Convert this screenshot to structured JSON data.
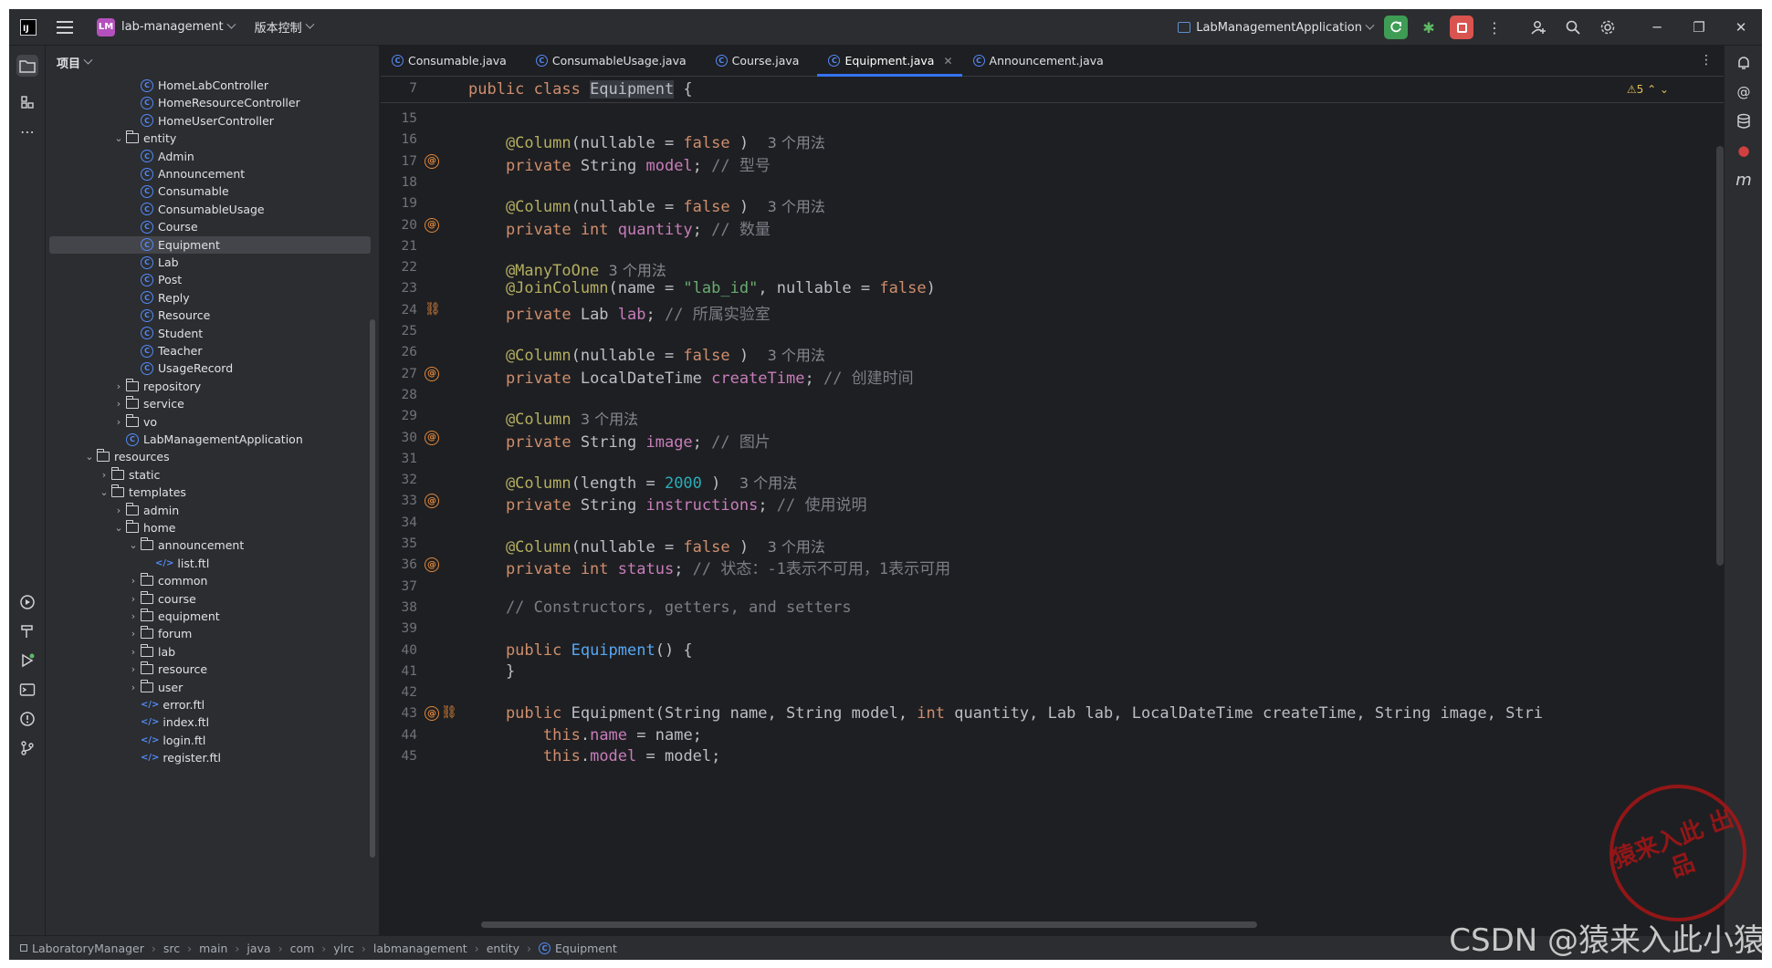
{
  "topbar": {
    "project_badge": "LM",
    "project_name": "lab-management",
    "vcs_label": "版本控制",
    "run_config": "LabManagementApplication"
  },
  "project_panel": {
    "title": "项目",
    "tree": [
      {
        "label": "HomeLabController",
        "type": "class",
        "depth": 5
      },
      {
        "label": "HomeResourceController",
        "type": "class",
        "depth": 5
      },
      {
        "label": "HomeUserController",
        "type": "class",
        "depth": 5
      },
      {
        "label": "entity",
        "type": "folder",
        "depth": 4,
        "expanded": true
      },
      {
        "label": "Admin",
        "type": "class",
        "depth": 5
      },
      {
        "label": "Announcement",
        "type": "class",
        "depth": 5
      },
      {
        "label": "Consumable",
        "type": "class",
        "depth": 5
      },
      {
        "label": "ConsumableUsage",
        "type": "class",
        "depth": 5
      },
      {
        "label": "Course",
        "type": "class",
        "depth": 5
      },
      {
        "label": "Equipment",
        "type": "class",
        "depth": 5,
        "selected": true
      },
      {
        "label": "Lab",
        "type": "class",
        "depth": 5
      },
      {
        "label": "Post",
        "type": "class",
        "depth": 5
      },
      {
        "label": "Reply",
        "type": "class",
        "depth": 5
      },
      {
        "label": "Resource",
        "type": "class",
        "depth": 5
      },
      {
        "label": "Student",
        "type": "class",
        "depth": 5
      },
      {
        "label": "Teacher",
        "type": "class",
        "depth": 5
      },
      {
        "label": "UsageRecord",
        "type": "class",
        "depth": 5
      },
      {
        "label": "repository",
        "type": "folder",
        "depth": 4,
        "expanded": false
      },
      {
        "label": "service",
        "type": "folder",
        "depth": 4,
        "expanded": false
      },
      {
        "label": "vo",
        "type": "folder",
        "depth": 4,
        "expanded": false
      },
      {
        "label": "LabManagementApplication",
        "type": "class",
        "depth": 4
      },
      {
        "label": "resources",
        "type": "folder",
        "depth": 2,
        "expanded": true
      },
      {
        "label": "static",
        "type": "folder",
        "depth": 3,
        "expanded": false
      },
      {
        "label": "templates",
        "type": "folder",
        "depth": 3,
        "expanded": true
      },
      {
        "label": "admin",
        "type": "folder",
        "depth": 4,
        "expanded": false
      },
      {
        "label": "home",
        "type": "folder",
        "depth": 4,
        "expanded": true
      },
      {
        "label": "announcement",
        "type": "folder",
        "depth": 5,
        "expanded": true
      },
      {
        "label": "list.ftl",
        "type": "ftl",
        "depth": 6
      },
      {
        "label": "common",
        "type": "folder",
        "depth": 5,
        "expanded": false
      },
      {
        "label": "course",
        "type": "folder",
        "depth": 5,
        "expanded": false
      },
      {
        "label": "equipment",
        "type": "folder",
        "depth": 5,
        "expanded": false
      },
      {
        "label": "forum",
        "type": "folder",
        "depth": 5,
        "expanded": false
      },
      {
        "label": "lab",
        "type": "folder",
        "depth": 5,
        "expanded": false
      },
      {
        "label": "resource",
        "type": "folder",
        "depth": 5,
        "expanded": false
      },
      {
        "label": "user",
        "type": "folder",
        "depth": 5,
        "expanded": false
      },
      {
        "label": "error.ftl",
        "type": "ftl",
        "depth": 5
      },
      {
        "label": "index.ftl",
        "type": "ftl",
        "depth": 5
      },
      {
        "label": "login.ftl",
        "type": "ftl",
        "depth": 5
      },
      {
        "label": "register.ftl",
        "type": "ftl",
        "depth": 5
      }
    ]
  },
  "tabs": [
    {
      "label": "Consumable.java",
      "active": false
    },
    {
      "label": "ConsumableUsage.java",
      "active": false
    },
    {
      "label": "Course.java",
      "active": false
    },
    {
      "label": "Equipment.java",
      "active": true
    },
    {
      "label": "Announcement.java",
      "active": false
    }
  ],
  "editor": {
    "sticky_line_number": "7",
    "sticky_header": "public class Equipment {",
    "warnings_count": "5",
    "line_numbers": [
      "15",
      "16",
      "17",
      "18",
      "19",
      "20",
      "21",
      "22",
      "23",
      "24",
      "25",
      "26",
      "27",
      "28",
      "29",
      "30",
      "31",
      "32",
      "33",
      "34",
      "35",
      "36",
      "37",
      "38",
      "39",
      "40",
      "41",
      "42",
      "43",
      "44",
      "45"
    ],
    "code": [
      {
        "n": "15",
        "tokens": []
      },
      {
        "n": "16",
        "tokens": [
          [
            "ann",
            "    @Column"
          ],
          [
            "",
            "(nullable = "
          ],
          [
            "kw",
            "false"
          ],
          [
            "",
            " )  "
          ],
          [
            "hint",
            "3 个用法"
          ]
        ]
      },
      {
        "n": "17",
        "mark": "at",
        "tokens": [
          [
            "kw",
            "    private "
          ],
          [
            "",
            "String "
          ],
          [
            "fld",
            "model"
          ],
          [
            "",
            "; "
          ],
          [
            "cmt",
            "// 型号"
          ]
        ]
      },
      {
        "n": "18",
        "tokens": []
      },
      {
        "n": "19",
        "tokens": [
          [
            "ann",
            "    @Column"
          ],
          [
            "",
            "(nullable = "
          ],
          [
            "kw",
            "false"
          ],
          [
            "",
            " )  "
          ],
          [
            "hint",
            "3 个用法"
          ]
        ]
      },
      {
        "n": "20",
        "mark": "at",
        "tokens": [
          [
            "kw",
            "    private int "
          ],
          [
            "fld",
            "quantity"
          ],
          [
            "",
            "; "
          ],
          [
            "cmt",
            "// 数量"
          ]
        ]
      },
      {
        "n": "21",
        "tokens": []
      },
      {
        "n": "22",
        "tokens": [
          [
            "ann",
            "    @ManyToOne"
          ],
          [
            "",
            " "
          ],
          [
            "hint",
            "3 个用法"
          ]
        ]
      },
      {
        "n": "23",
        "tokens": [
          [
            "ann",
            "    @JoinColumn"
          ],
          [
            "",
            "(name = "
          ],
          [
            "str",
            "\"lab_id\""
          ],
          [
            "",
            ", nullable = "
          ],
          [
            "kw",
            "false"
          ],
          [
            "",
            ")"
          ]
        ]
      },
      {
        "n": "24",
        "mark": "link",
        "tokens": [
          [
            "kw",
            "    private "
          ],
          [
            "",
            "Lab "
          ],
          [
            "fld",
            "lab"
          ],
          [
            "",
            "; "
          ],
          [
            "cmt",
            "// 所属实验室"
          ]
        ]
      },
      {
        "n": "25",
        "tokens": []
      },
      {
        "n": "26",
        "tokens": [
          [
            "ann",
            "    @Column"
          ],
          [
            "",
            "(nullable = "
          ],
          [
            "kw",
            "false"
          ],
          [
            "",
            " )  "
          ],
          [
            "hint",
            "3 个用法"
          ]
        ]
      },
      {
        "n": "27",
        "mark": "at",
        "tokens": [
          [
            "kw",
            "    private "
          ],
          [
            "",
            "LocalDateTime "
          ],
          [
            "fld",
            "createTime"
          ],
          [
            "",
            "; "
          ],
          [
            "cmt",
            "// 创建时间"
          ]
        ]
      },
      {
        "n": "28",
        "tokens": []
      },
      {
        "n": "29",
        "tokens": [
          [
            "ann",
            "    @Column"
          ],
          [
            "",
            " "
          ],
          [
            "hint",
            "3 个用法"
          ]
        ]
      },
      {
        "n": "30",
        "mark": "at",
        "tokens": [
          [
            "kw",
            "    private "
          ],
          [
            "",
            "String "
          ],
          [
            "fld",
            "image"
          ],
          [
            "",
            "; "
          ],
          [
            "cmt",
            "// 图片"
          ]
        ]
      },
      {
        "n": "31",
        "tokens": []
      },
      {
        "n": "32",
        "tokens": [
          [
            "ann",
            "    @Column"
          ],
          [
            "",
            "(length = "
          ],
          [
            "num",
            "2000"
          ],
          [
            "",
            " )  "
          ],
          [
            "hint",
            "3 个用法"
          ]
        ]
      },
      {
        "n": "33",
        "mark": "at",
        "tokens": [
          [
            "kw",
            "    private "
          ],
          [
            "",
            "String "
          ],
          [
            "fld",
            "instructions"
          ],
          [
            "",
            "; "
          ],
          [
            "cmt",
            "// 使用说明"
          ]
        ]
      },
      {
        "n": "34",
        "tokens": []
      },
      {
        "n": "35",
        "tokens": [
          [
            "ann",
            "    @Column"
          ],
          [
            "",
            "(nullable = "
          ],
          [
            "kw",
            "false"
          ],
          [
            "",
            " )  "
          ],
          [
            "hint",
            "3 个用法"
          ]
        ]
      },
      {
        "n": "36",
        "mark": "at",
        "tokens": [
          [
            "kw",
            "    private int "
          ],
          [
            "fld",
            "status"
          ],
          [
            "",
            "; "
          ],
          [
            "cmt",
            "// 状态：-1表示不可用，1表示可用"
          ]
        ]
      },
      {
        "n": "37",
        "tokens": []
      },
      {
        "n": "38",
        "tokens": [
          [
            "cmt",
            "    // Constructors, getters, and setters"
          ]
        ]
      },
      {
        "n": "39",
        "tokens": []
      },
      {
        "n": "40",
        "tokens": [
          [
            "kw",
            "    public "
          ],
          [
            "fn",
            "Equipment"
          ],
          [
            "",
            "() {"
          ]
        ]
      },
      {
        "n": "41",
        "tokens": [
          [
            "",
            "    }"
          ]
        ]
      },
      {
        "n": "42",
        "tokens": []
      },
      {
        "n": "43",
        "mark": "atlink",
        "tokens": [
          [
            "kw",
            "    public "
          ],
          [
            "",
            "Equipment(String name, String model, "
          ],
          [
            "kw",
            "int "
          ],
          [
            "",
            "quantity, Lab lab, LocalDateTime createTime, String image, Stri"
          ]
        ]
      },
      {
        "n": "44",
        "tokens": [
          [
            "kw",
            "        this"
          ],
          [
            "",
            "."
          ],
          [
            "fld",
            "name"
          ],
          [
            "",
            " = name;"
          ]
        ]
      },
      {
        "n": "45",
        "tokens": [
          [
            "kw",
            "        this"
          ],
          [
            "",
            "."
          ],
          [
            "fld",
            "model"
          ],
          [
            "",
            " = model;"
          ]
        ]
      }
    ]
  },
  "statusbar": {
    "breadcrumbs": [
      "LaboratoryManager",
      "src",
      "main",
      "java",
      "com",
      "ylrc",
      "labmanagement",
      "entity",
      "Equipment"
    ]
  },
  "watermark": {
    "stamp_text": "猿来入此 出品",
    "csdn_text": "CSDN @猿来入此小猿"
  }
}
